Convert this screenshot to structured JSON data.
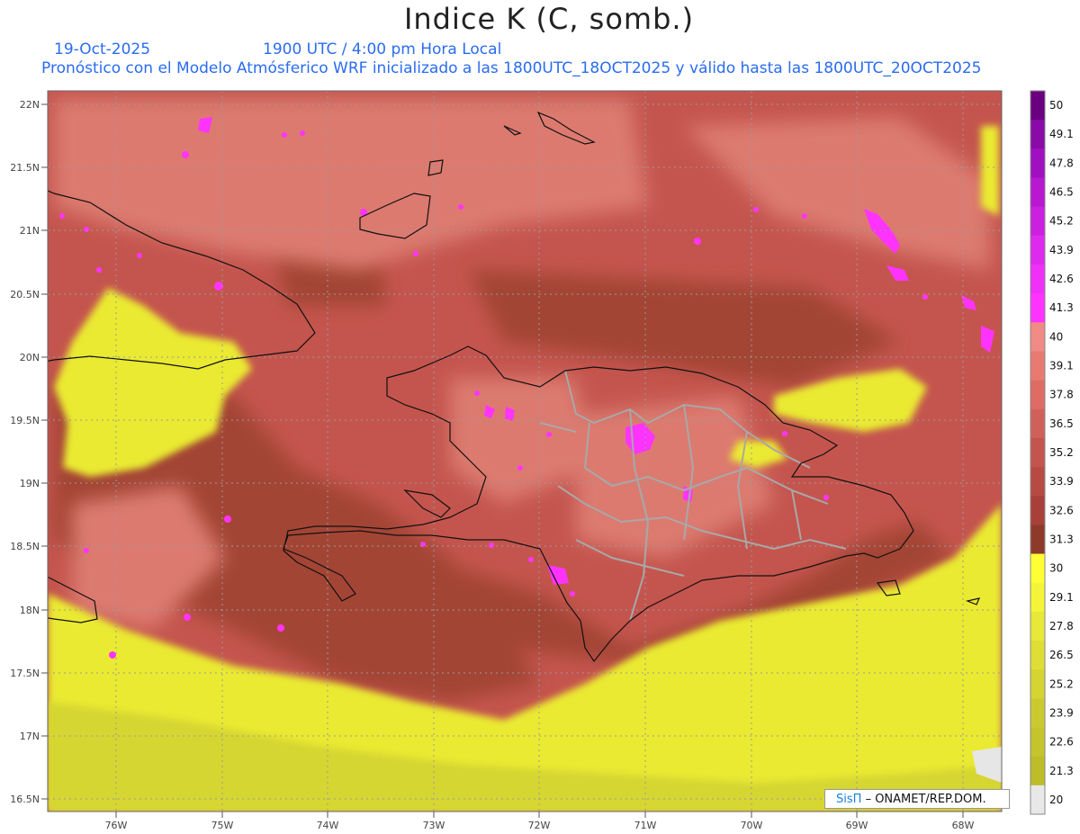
{
  "title": "Indice K (C, somb.)",
  "date_label": "19-Oct-2025",
  "time_label": "1900 UTC / 4:00 pm Hora Local",
  "forecast_line": "Pronóstico con el Modelo Atmósferico WRF inicializado a las 1800UTC_18OCT2025 y válido hasta las  1800UTC_20OCT2025",
  "credit": {
    "brand": "SisΠ",
    "text": "– ONAMET/REP.DOM."
  },
  "lat_ticks": [
    "22N",
    "21.5N",
    "21N",
    "20.5N",
    "20N",
    "19.5N",
    "19N",
    "18.5N",
    "18N",
    "17.5N",
    "17N",
    "16.5N"
  ],
  "lon_ticks": [
    "76W",
    "75W",
    "74W",
    "73W",
    "72W",
    "71W",
    "70W",
    "69W",
    "68W"
  ],
  "colorbar": {
    "levels": [
      "50",
      "49.1",
      "47.8",
      "46.5",
      "45.2",
      "43.9",
      "42.6",
      "41.3",
      "40",
      "39.1",
      "37.8",
      "36.5",
      "35.2",
      "33.9",
      "32.6",
      "31.3",
      "30",
      "29.1",
      "27.8",
      "26.5",
      "25.2",
      "23.9",
      "22.6",
      "21.3",
      "20"
    ],
    "colors": [
      "#6a0080",
      "#8a0aa8",
      "#a010c0",
      "#b818d0",
      "#cc20e0",
      "#de2aee",
      "#ee30f8",
      "#ff33ff",
      "#f08a84",
      "#e87a72",
      "#de6c64",
      "#d0605a",
      "#c4554e",
      "#b84a44",
      "#a8403a",
      "#8e3a2a",
      "#ffff33",
      "#f4f438",
      "#e8e838",
      "#dede36",
      "#d4d433",
      "#caca30",
      "#c4c42c",
      "#bcbc28",
      "#e8e8e8"
    ]
  },
  "field_colors": {
    "ocean_base": "#c4554e",
    "dark": "#9a4030",
    "light": "#e08078",
    "low": "#eaea30",
    "high": "#ff33ff",
    "coast": "#111111",
    "borders": "#a0a0a0"
  }
}
